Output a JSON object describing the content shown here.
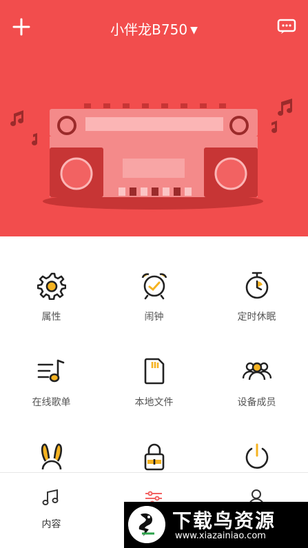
{
  "header": {
    "device_name": "小伴龙B750",
    "caret": "▼",
    "bg_color": "#f24d4d",
    "icons": [
      "plus-icon",
      "message-icon"
    ]
  },
  "functions": [
    {
      "label": "属性",
      "icon": "gear-icon"
    },
    {
      "label": "闹钟",
      "icon": "alarm-clock-icon"
    },
    {
      "label": "定时休眠",
      "icon": "stopwatch-icon"
    },
    {
      "label": "在线歌单",
      "icon": "playlist-icon"
    },
    {
      "label": "本地文件",
      "icon": "sd-card-icon"
    },
    {
      "label": "设备成员",
      "icon": "members-icon"
    },
    {
      "label": "",
      "icon": "bunny-icon"
    },
    {
      "label": "",
      "icon": "lock-icon"
    },
    {
      "label": "",
      "icon": "power-icon"
    }
  ],
  "tabbar": {
    "items": [
      {
        "label": "内容",
        "icon": "music-note-icon"
      },
      {
        "label": "",
        "icon": "sliders-icon"
      },
      {
        "label": "",
        "icon": "user-icon"
      }
    ]
  },
  "watermark": {
    "title": "下载鸟资源",
    "url": "www.xiazainiao.com"
  }
}
